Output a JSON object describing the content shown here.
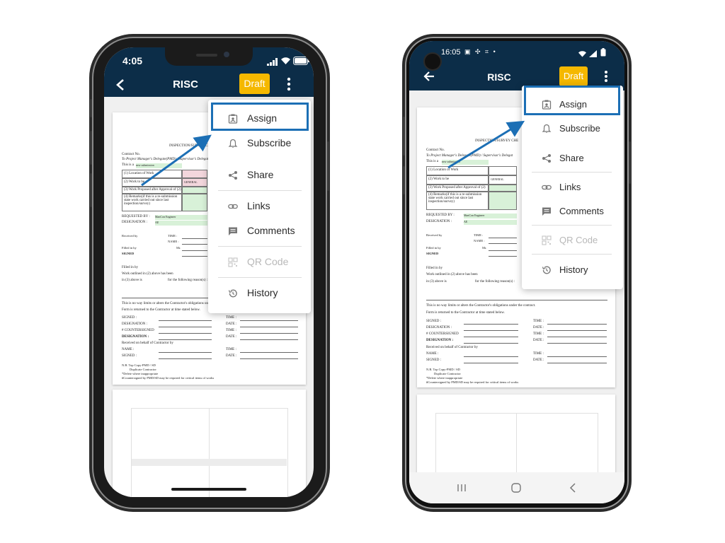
{
  "app": {
    "title": "RISC",
    "draft_label": "Draft"
  },
  "iphone_status": {
    "time": "4:05"
  },
  "android_status": {
    "time": "16:05",
    "notification_icons": "▣ ✣ ⌗ •"
  },
  "menu": {
    "items": [
      {
        "label": "Assign",
        "icon": "assign-icon",
        "enabled": true
      },
      {
        "label": "Subscribe",
        "icon": "bell-icon",
        "enabled": true
      },
      {
        "label": "Share",
        "icon": "share-icon",
        "enabled": true
      },
      {
        "label": "Links",
        "icon": "link-icon",
        "enabled": true
      },
      {
        "label": "Comments",
        "icon": "comment-icon",
        "enabled": true
      },
      {
        "label": "QR Code",
        "icon": "qr-code-icon",
        "enabled": false
      },
      {
        "label": "History",
        "icon": "history-icon",
        "enabled": true
      }
    ]
  },
  "document": {
    "heading": "INSPECTION/SURVEY CHE",
    "contract_no": "Contract No.",
    "delegate": "To Project Manager's Delegate(PMD) / Supervisor's Delegat",
    "this_is_a": "This is a",
    "new_submission": "new submission",
    "row1": "(1) Location of Work",
    "row2": "(2) Work to be",
    "row3": "(3) Work Proposed after Approval of (2)",
    "row4": "(4) Remarks(if this is a re-submission state work carried out since last inspection/survey)",
    "general": "GENERAL",
    "requested_by": "REQUESTED BY :",
    "designation": "DESIGNATION :",
    "requested_value": "ManCon Engineer",
    "designation_value": "AE",
    "received_by": "Received by",
    "time": "TIME :",
    "name": "NAME :",
    "filled_in_by": "Filled in by",
    "mr": "Mr.",
    "signed": "SIGNED",
    "work_outlined": "Work outlined in (2) above has been",
    "in3": "in (3) above is",
    "following_reasons": "for the following reason(s) :",
    "no_way": "This is no way limits or alters the Contractor's obligations under the contract.",
    "form_returned": "Form is returned to the Contractor at time stated below.",
    "signed_colon": "SIGNED      :",
    "designation_colon": "DESIGNATION   :",
    "countersigned": "# COUNTERSIGNED",
    "date": "DATE :",
    "received_contractor": "Received on behalf of Contractor by",
    "name_colon": "NAME          :",
    "signed2": "SIGNED        :",
    "nb": "N.B. Top Copy-PMD / SD",
    "duplicate": "Duplicate  Contractor",
    "delete": "*Delete where inappropriate",
    "countersigned_note": "#Countersigned by PMD/SD may be required for critical items of works"
  }
}
